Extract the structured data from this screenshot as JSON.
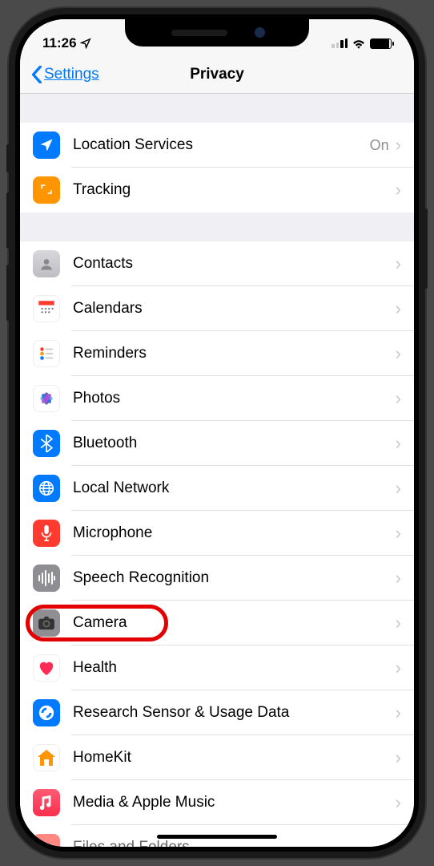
{
  "status": {
    "time": "11:26",
    "location_active": true
  },
  "nav": {
    "back_label": "Settings",
    "title": "Privacy"
  },
  "sections": [
    {
      "rows": [
        {
          "id": "location-services",
          "icon": "location-arrow-icon",
          "label": "Location Services",
          "value": "On"
        },
        {
          "id": "tracking",
          "icon": "tracking-icon",
          "label": "Tracking"
        }
      ]
    },
    {
      "rows": [
        {
          "id": "contacts",
          "icon": "contacts-icon",
          "label": "Contacts"
        },
        {
          "id": "calendars",
          "icon": "calendar-icon",
          "label": "Calendars"
        },
        {
          "id": "reminders",
          "icon": "reminders-icon",
          "label": "Reminders"
        },
        {
          "id": "photos",
          "icon": "photos-icon",
          "label": "Photos"
        },
        {
          "id": "bluetooth",
          "icon": "bluetooth-icon",
          "label": "Bluetooth"
        },
        {
          "id": "local-network",
          "icon": "local-network-icon",
          "label": "Local Network"
        },
        {
          "id": "microphone",
          "icon": "microphone-icon",
          "label": "Microphone"
        },
        {
          "id": "speech-recognition",
          "icon": "speech-recognition-icon",
          "label": "Speech Recognition"
        },
        {
          "id": "camera",
          "icon": "camera-icon",
          "label": "Camera",
          "highlighted": true
        },
        {
          "id": "health",
          "icon": "health-icon",
          "label": "Health"
        },
        {
          "id": "research",
          "icon": "research-icon",
          "label": "Research Sensor & Usage Data"
        },
        {
          "id": "homekit",
          "icon": "homekit-icon",
          "label": "HomeKit"
        },
        {
          "id": "media-music",
          "icon": "music-icon",
          "label": "Media & Apple Music"
        },
        {
          "id": "files-folders",
          "icon": "files-folders-icon",
          "label": "Files and Folders"
        }
      ]
    }
  ]
}
